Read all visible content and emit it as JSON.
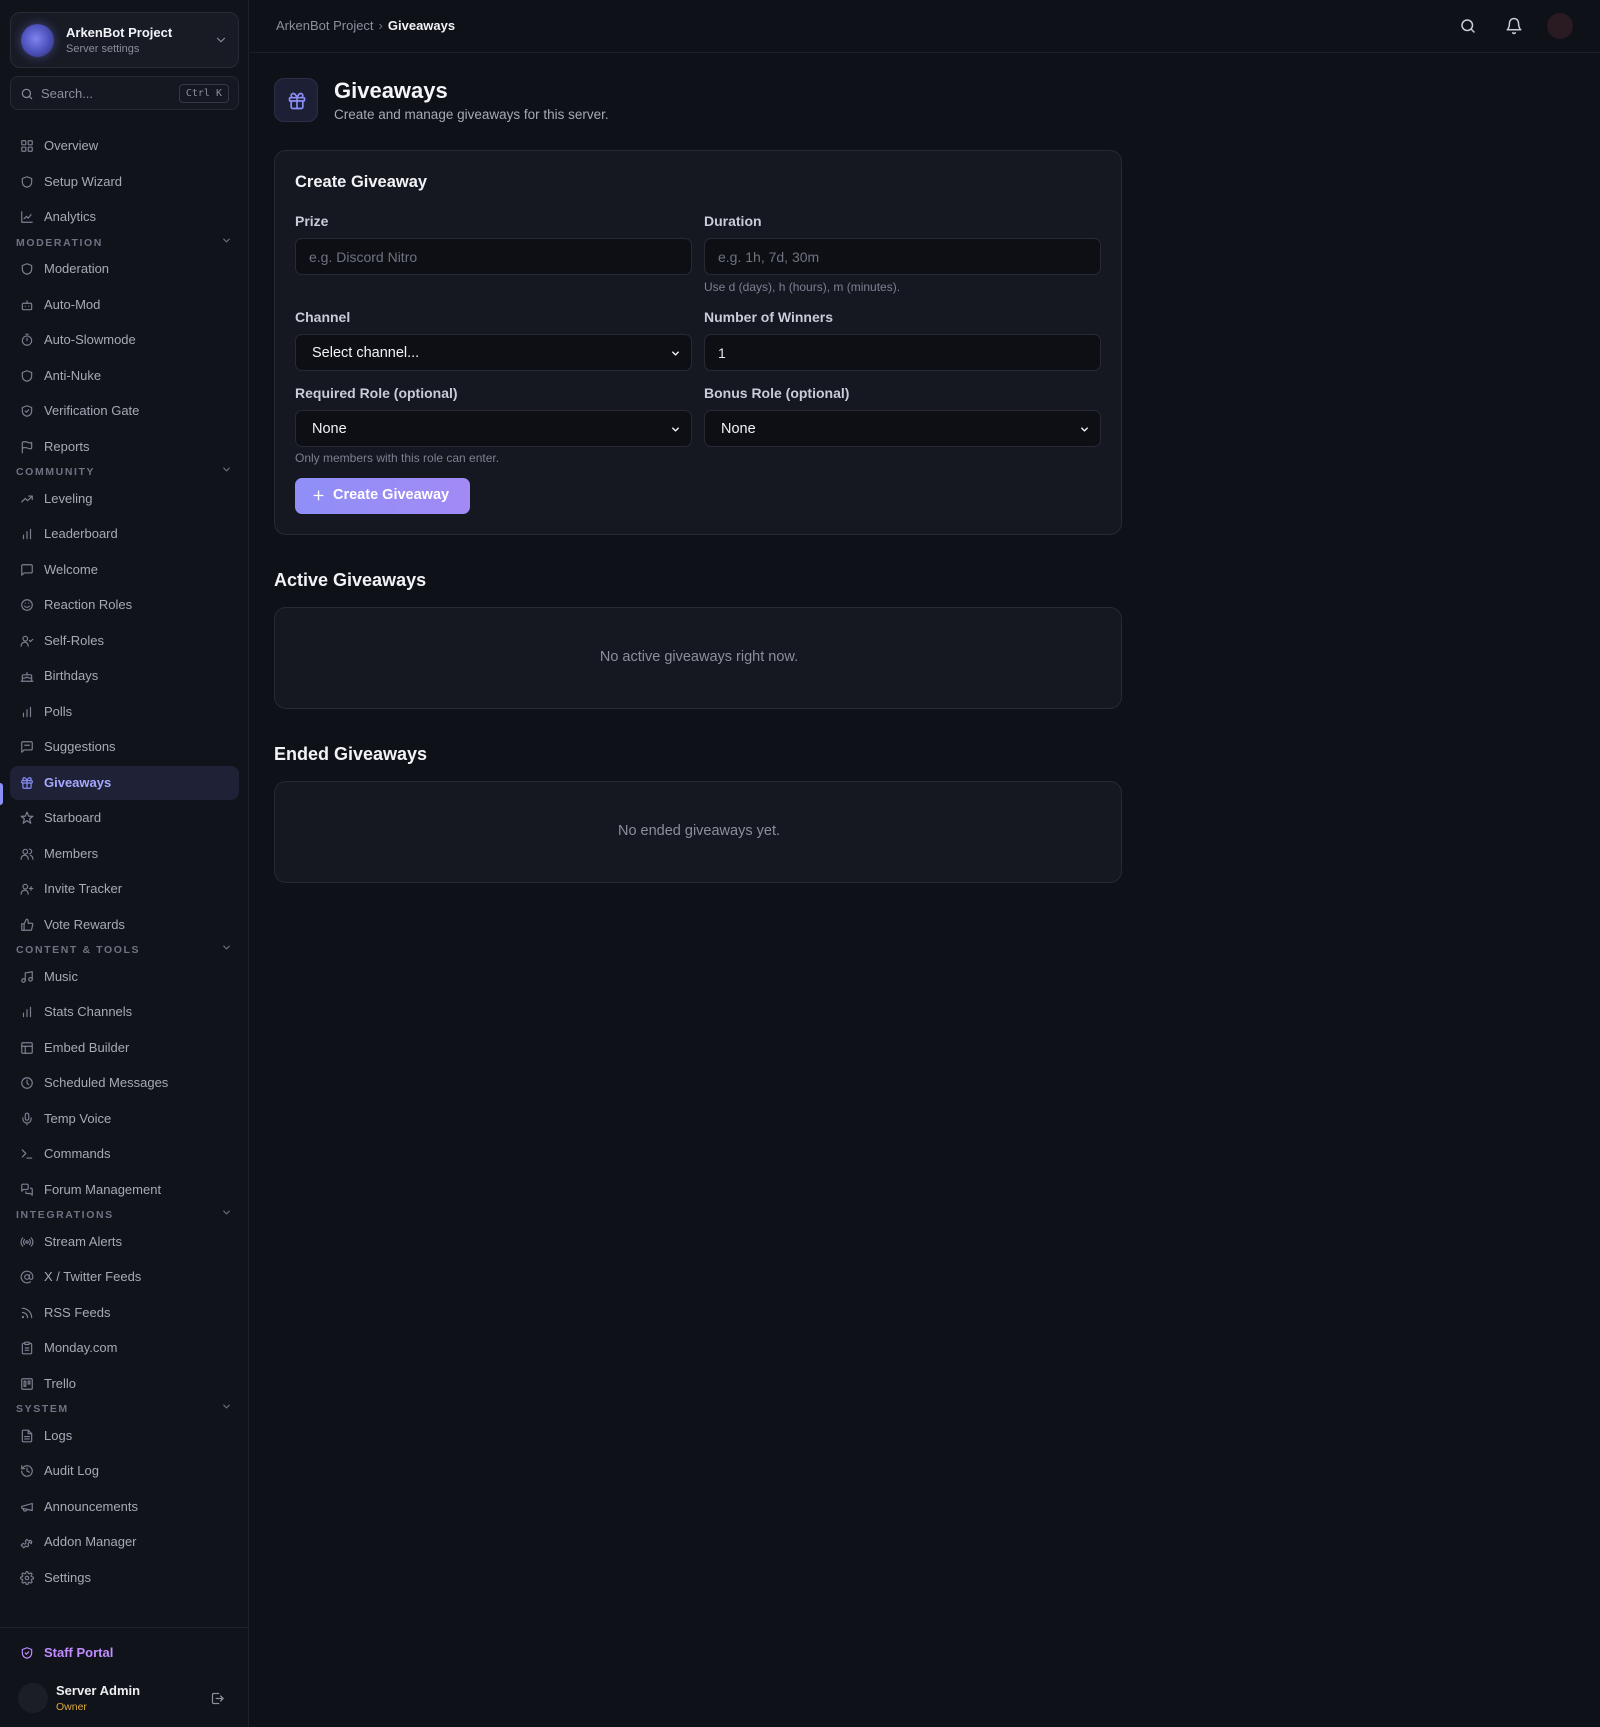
{
  "colors": {
    "background": "#0f1118",
    "sidebar": "#11131b",
    "accent": "#8b8ef7",
    "staff_portal": "#c08cff",
    "owner_badge": "#d7a93a"
  },
  "server": {
    "name": "ArkenBot Project",
    "subtitle": "Server settings",
    "chevron_icon": "chevron-down-icon"
  },
  "search": {
    "placeholder": "Search...",
    "shortcut": "Ctrl K"
  },
  "nav": {
    "top": [
      {
        "label": "Overview",
        "icon": "grid-icon"
      },
      {
        "label": "Setup Wizard",
        "icon": "shield-icon"
      },
      {
        "label": "Analytics",
        "icon": "line-chart-icon"
      }
    ],
    "sections": [
      {
        "title": "MODERATION",
        "items": [
          {
            "label": "Moderation",
            "icon": "shield-icon"
          },
          {
            "label": "Auto-Mod",
            "icon": "bot-icon"
          },
          {
            "label": "Auto-Slowmode",
            "icon": "timer-icon"
          },
          {
            "label": "Anti-Nuke",
            "icon": "shield-icon"
          },
          {
            "label": "Verification Gate",
            "icon": "shield-check-icon"
          },
          {
            "label": "Reports",
            "icon": "flag-icon"
          }
        ]
      },
      {
        "title": "COMMUNITY",
        "items": [
          {
            "label": "Leveling",
            "icon": "trending-up-icon"
          },
          {
            "label": "Leaderboard",
            "icon": "bar-chart-icon"
          },
          {
            "label": "Welcome",
            "icon": "message-icon"
          },
          {
            "label": "Reaction Roles",
            "icon": "smile-icon"
          },
          {
            "label": "Self-Roles",
            "icon": "user-check-icon"
          },
          {
            "label": "Birthdays",
            "icon": "cake-icon"
          },
          {
            "label": "Polls",
            "icon": "bar-chart-icon"
          },
          {
            "label": "Suggestions",
            "icon": "message-square-icon"
          },
          {
            "label": "Giveaways",
            "icon": "gift-icon",
            "active": true
          },
          {
            "label": "Starboard",
            "icon": "star-icon"
          },
          {
            "label": "Members",
            "icon": "users-icon"
          },
          {
            "label": "Invite Tracker",
            "icon": "user-plus-icon"
          },
          {
            "label": "Vote Rewards",
            "icon": "thumbs-up-icon"
          }
        ]
      },
      {
        "title": "CONTENT & TOOLS",
        "items": [
          {
            "label": "Music",
            "icon": "music-icon"
          },
          {
            "label": "Stats Channels",
            "icon": "bar-chart-icon"
          },
          {
            "label": "Embed Builder",
            "icon": "layout-icon"
          },
          {
            "label": "Scheduled Messages",
            "icon": "clock-icon"
          },
          {
            "label": "Temp Voice",
            "icon": "mic-icon"
          },
          {
            "label": "Commands",
            "icon": "terminal-icon"
          },
          {
            "label": "Forum Management",
            "icon": "messages-icon"
          }
        ]
      },
      {
        "title": "INTEGRATIONS",
        "items": [
          {
            "label": "Stream Alerts",
            "icon": "radio-icon"
          },
          {
            "label": "X / Twitter Feeds",
            "icon": "at-sign-icon"
          },
          {
            "label": "RSS Feeds",
            "icon": "rss-icon"
          },
          {
            "label": "Monday.com",
            "icon": "clipboard-icon"
          },
          {
            "label": "Trello",
            "icon": "trello-icon"
          }
        ]
      },
      {
        "title": "SYSTEM",
        "items": [
          {
            "label": "Logs",
            "icon": "file-text-icon"
          },
          {
            "label": "Audit Log",
            "icon": "history-icon"
          },
          {
            "label": "Announcements",
            "icon": "megaphone-icon"
          },
          {
            "label": "Addon Manager",
            "icon": "puzzle-icon"
          },
          {
            "label": "Settings",
            "icon": "gear-icon"
          }
        ]
      }
    ]
  },
  "staff_portal": {
    "label": "Staff Portal",
    "icon": "shield-check-icon"
  },
  "user": {
    "name": "Server Admin",
    "role": "Owner"
  },
  "breadcrumb": {
    "parent": "ArkenBot Project",
    "separator": "›",
    "current": "Giveaways"
  },
  "page": {
    "title": "Giveaways",
    "subtitle": "Create and manage giveaways for this server.",
    "icon": "gift-icon"
  },
  "create_form": {
    "title": "Create Giveaway",
    "prize_label": "Prize",
    "prize_placeholder": "e.g. Discord Nitro",
    "duration_label": "Duration",
    "duration_placeholder": "e.g. 1h, 7d, 30m",
    "duration_hint": "Use d (days), h (hours), m (minutes).",
    "channel_label": "Channel",
    "channel_value": "Select channel...",
    "winners_label": "Number of Winners",
    "winners_value": "1",
    "required_role_label": "Required Role (optional)",
    "required_role_value": "None",
    "required_role_hint": "Only members with this role can enter.",
    "bonus_role_label": "Bonus Role (optional)",
    "bonus_role_value": "None",
    "submit_label": "Create Giveaway"
  },
  "active": {
    "title": "Active Giveaways",
    "empty": "No active giveaways right now."
  },
  "ended": {
    "title": "Ended Giveaways",
    "empty": "No ended giveaways yet."
  }
}
